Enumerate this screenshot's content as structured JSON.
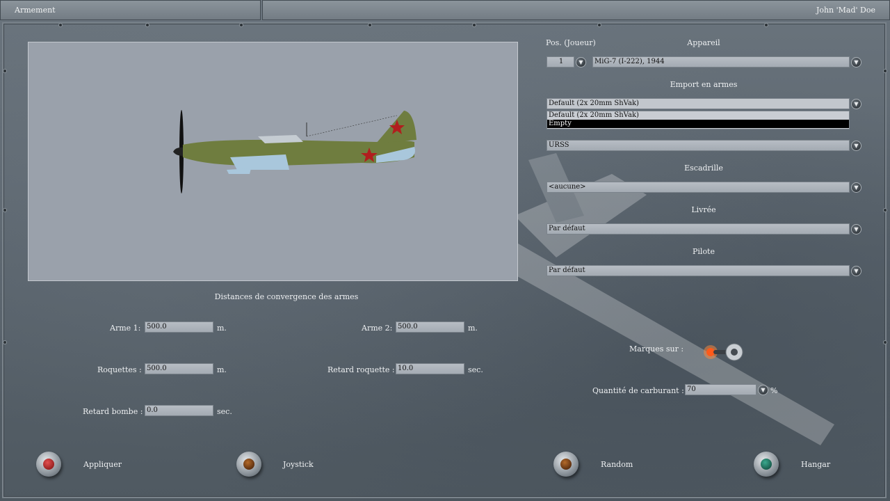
{
  "header": {
    "screen_title": "Armement",
    "player_name": "John 'Mad' Doe"
  },
  "selection": {
    "position_label": "Pos. (Joueur)",
    "position_value": "1",
    "aircraft_label": "Appareil",
    "aircraft_value": "MiG-7 (I-222), 1944",
    "loadout_label": "Emport en armes",
    "loadout_value": "Default (2x 20mm ShVak)",
    "loadout_options": [
      "Default (2x 20mm ShVak)",
      "Empty"
    ],
    "loadout_selected_option": "Empty",
    "country_value": "URSS",
    "squadron_label": "Escadrille",
    "squadron_value": "<aucune>",
    "livery_label": "Livrée",
    "livery_value": "Par défaut",
    "pilot_label": "Pilote",
    "pilot_value": "Par défaut"
  },
  "convergence": {
    "title": "Distances de convergence des armes",
    "weapon1_label": "Arme 1:",
    "weapon1_value": "500.0",
    "weapon1_unit": "m.",
    "weapon2_label": "Arme 2:",
    "weapon2_value": "500.0",
    "weapon2_unit": "m.",
    "rockets_label": "Roquettes :",
    "rockets_value": "500.0",
    "rockets_unit": "m.",
    "rocket_delay_label": "Retard roquette :",
    "rocket_delay_value": "10.0",
    "rocket_delay_unit": "sec.",
    "bomb_delay_label": "Retard bombe :",
    "bomb_delay_value": "0.0",
    "bomb_delay_unit": "sec."
  },
  "options": {
    "markings_label": "Marques sur :",
    "markings_on": true,
    "fuel_label": "Quantité de carburant :",
    "fuel_value": "70",
    "fuel_unit": "%"
  },
  "buttons": {
    "apply_label": "Appliquer",
    "joystick_label": "Joystick",
    "random_label": "Random",
    "hangar_label": "Hangar"
  },
  "colors": {
    "lamp_red": "#c23030",
    "lamp_amber": "#7a3a12",
    "lamp_teal": "#1f7a64"
  },
  "icons": {
    "dropdown": "chevron-down-icon",
    "plane": "aircraft-preview"
  }
}
